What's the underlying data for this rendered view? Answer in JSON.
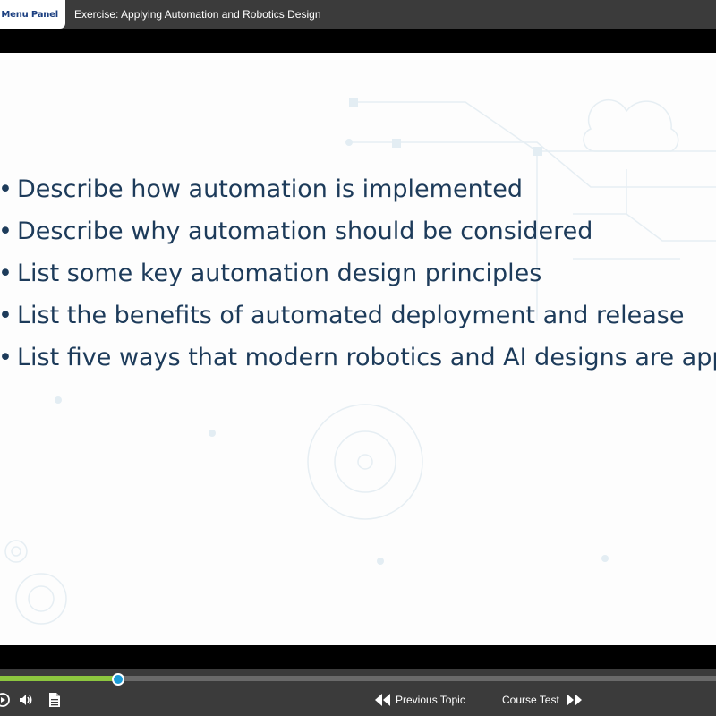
{
  "header": {
    "menu_button_label": "Menu Panel",
    "course_title": "Exercise: Applying Automation and Robotics Design"
  },
  "slide": {
    "bullets": [
      "Describe how automation is implemented",
      "Describe why automation should be considered",
      "List some key automation design principles",
      "List the benefits of automated deployment and release",
      "List five ways that modern robotics and AI designs are applied"
    ]
  },
  "player": {
    "progress": 0.165,
    "colors": {
      "progress_fill": "#8cc63f",
      "knob": "#1a9bd7",
      "bar_bg": "#3b3b3b"
    },
    "controls": [
      "replay-icon",
      "volume-icon",
      "transcript-icon"
    ],
    "prev_label": "Previous Topic",
    "next_label": "Course Test"
  }
}
